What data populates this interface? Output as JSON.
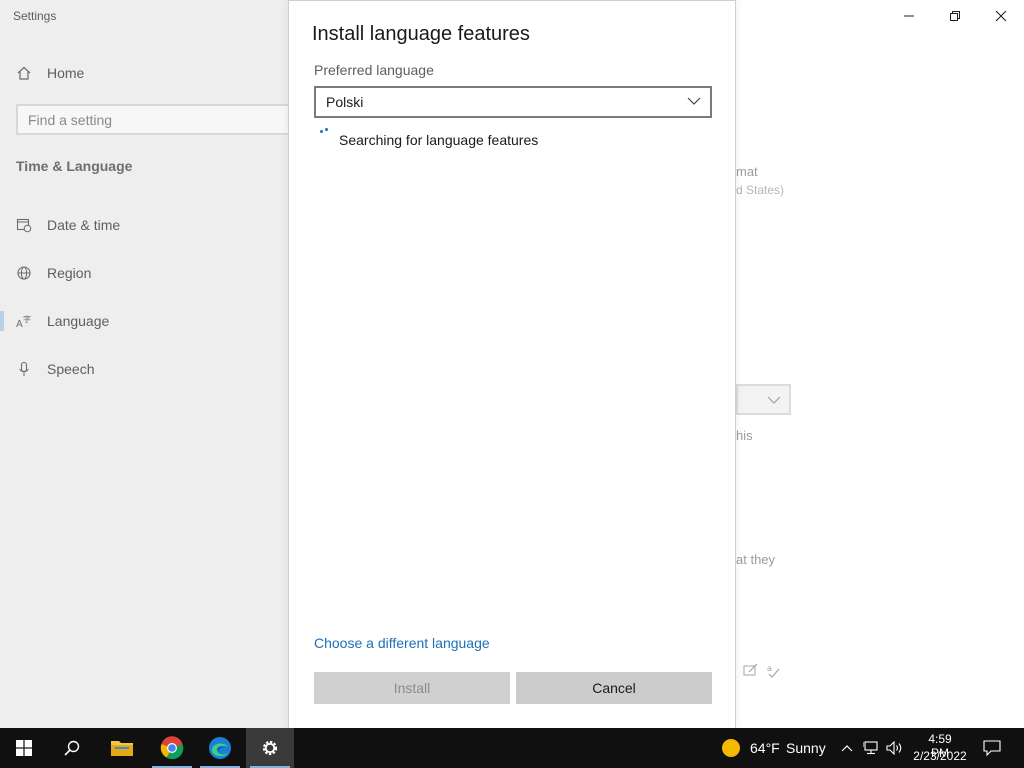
{
  "settings": {
    "window_title": "Settings",
    "nav": {
      "home": "Home",
      "search_placeholder": "Find a setting",
      "section": "Time & Language",
      "items": [
        "Date & time",
        "Region",
        "Language",
        "Speech"
      ]
    },
    "bg_text": {
      "format": "mat",
      "region": "d States)",
      "this": "his",
      "they": "at they"
    }
  },
  "dialog": {
    "title": "Install language features",
    "preferred_label": "Preferred language",
    "selected_language": "Polski",
    "status": "Searching for language features",
    "link": "Choose a different language",
    "install_label": "Install",
    "cancel_label": "Cancel"
  },
  "taskbar": {
    "weather_temp": "64°F",
    "weather_condition": "Sunny",
    "time": "4:59 PM",
    "date": "2/23/2022"
  },
  "colors": {
    "accent": "#1d6fb8",
    "taskbar": "#101010"
  }
}
